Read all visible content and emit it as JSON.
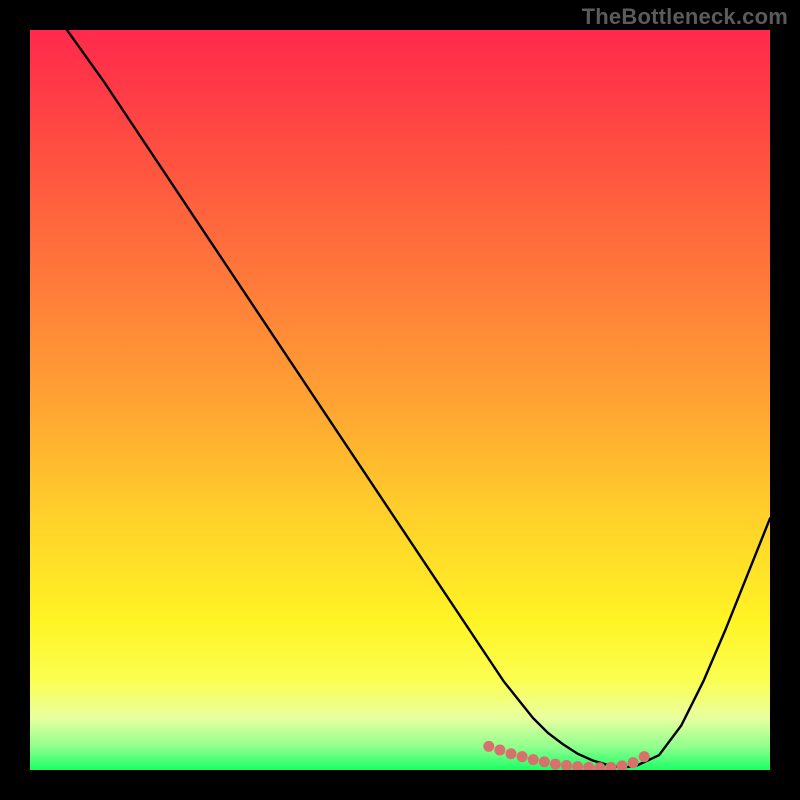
{
  "watermark": "TheBottleneck.com",
  "chart_data": {
    "type": "line",
    "title": "",
    "xlabel": "",
    "ylabel": "",
    "xlim": [
      0,
      100
    ],
    "ylim": [
      0,
      100
    ],
    "grid": false,
    "legend": false,
    "x": [
      5,
      10,
      15,
      20,
      25,
      30,
      35,
      40,
      45,
      50,
      55,
      60,
      62,
      64,
      66,
      68,
      70,
      72,
      74,
      76,
      78,
      80,
      82,
      85,
      88,
      91,
      94,
      97,
      100
    ],
    "values": [
      100,
      93,
      85.5,
      78,
      70.5,
      63,
      55.5,
      48,
      40.5,
      33,
      25.5,
      18,
      15,
      12,
      9.5,
      7,
      5,
      3.5,
      2.2,
      1.3,
      0.7,
      0.3,
      0.6,
      2,
      6,
      12,
      19,
      26.5,
      34
    ],
    "marker_x": [
      62,
      63.5,
      65,
      66.5,
      68,
      69.5,
      71,
      72.5,
      74,
      75.5,
      77,
      78.5,
      80,
      81.5,
      83
    ],
    "marker_values": [
      3.2,
      2.7,
      2.2,
      1.8,
      1.4,
      1.1,
      0.8,
      0.6,
      0.45,
      0.35,
      0.3,
      0.35,
      0.55,
      1.0,
      1.8
    ],
    "gradient_stops": [
      {
        "pct": 0,
        "color": "#ff2a4d"
      },
      {
        "pct": 6,
        "color": "#ff3648"
      },
      {
        "pct": 18,
        "color": "#ff5340"
      },
      {
        "pct": 34,
        "color": "#ff7a3a"
      },
      {
        "pct": 50,
        "color": "#ffa233"
      },
      {
        "pct": 66,
        "color": "#ffd12a"
      },
      {
        "pct": 80,
        "color": "#fff425"
      },
      {
        "pct": 88,
        "color": "#fbff53"
      },
      {
        "pct": 93,
        "color": "#e8ffa0"
      },
      {
        "pct": 97,
        "color": "#8cff8c"
      },
      {
        "pct": 100,
        "color": "#1aff66"
      }
    ],
    "line_color": "#000000",
    "marker_color": "#d8716b"
  }
}
